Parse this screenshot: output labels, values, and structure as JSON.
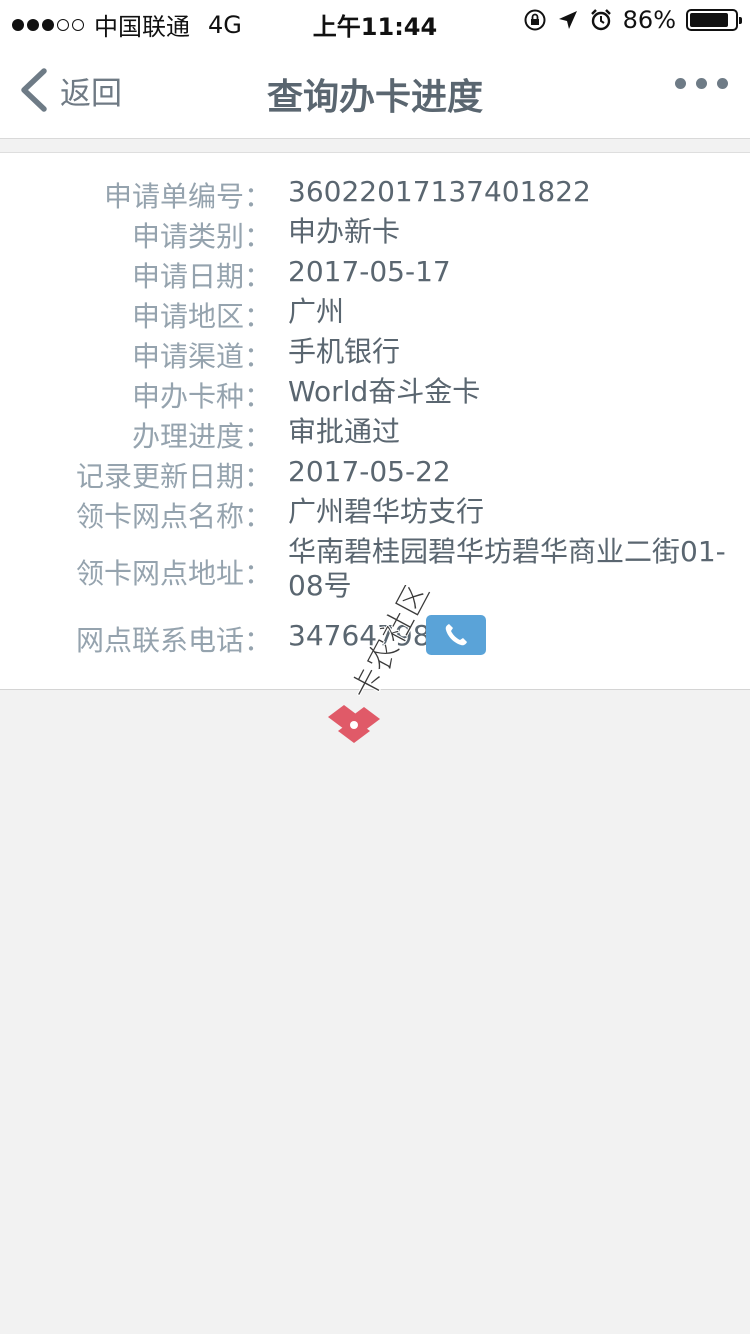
{
  "status_bar": {
    "signal_dots": "●●●○○",
    "carrier": "中国联通",
    "network": "4G",
    "time": "上午11:44",
    "battery": "86%",
    "battery_level": 0.86,
    "icons": [
      "orientation-lock-icon",
      "location-arrow-icon",
      "alarm-icon",
      "battery-icon"
    ]
  },
  "nav": {
    "back_label": "返回",
    "title": "查询办卡进度",
    "more_icon": "more-dots-icon"
  },
  "details": [
    {
      "key": "申请单编号：",
      "value": "36022017137401822"
    },
    {
      "key": "申请类别：",
      "value": "申办新卡"
    },
    {
      "key": "申请日期：",
      "value": "2017-05-17"
    },
    {
      "key": "申请地区：",
      "value": "广州"
    },
    {
      "key": "申请渠道：",
      "value": "手机银行"
    },
    {
      "key": "申办卡种：",
      "value": "World奋斗金卡"
    },
    {
      "key": "办理进度：",
      "value": "审批通过"
    },
    {
      "key": "记录更新日期：",
      "value": "2017-05-22"
    },
    {
      "key": "领卡网点名称：",
      "value": "广州碧华坊支行"
    },
    {
      "key": "领卡网点地址：",
      "value": "华南碧桂园碧华坊碧华商业二街01-08号"
    },
    {
      "key": "网点联系电话：",
      "value": "34764798"
    }
  ],
  "watermark": {
    "text": "卡农社区"
  },
  "colors": {
    "label": "#95a3ae",
    "value": "#5a6670",
    "phone_button": "#5aa3d8",
    "background": "#f2f2f2"
  }
}
